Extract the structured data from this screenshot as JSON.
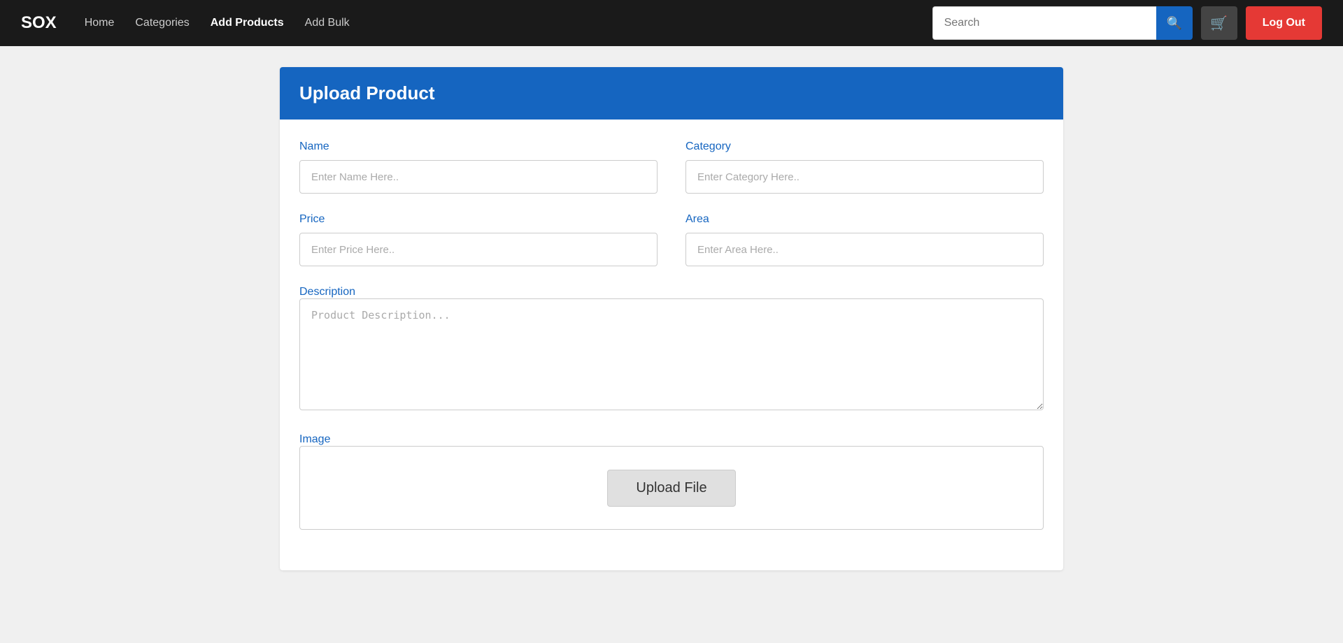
{
  "brand": "SOX",
  "navbar": {
    "links": [
      {
        "label": "Home",
        "active": false
      },
      {
        "label": "Categories",
        "active": false
      },
      {
        "label": "Add Products",
        "active": true
      },
      {
        "label": "Add Bulk",
        "active": false
      }
    ],
    "search_placeholder": "Search",
    "logout_label": "Log Out"
  },
  "form": {
    "title": "Upload Product",
    "name_label": "Name",
    "name_placeholder": "Enter Name Here..",
    "category_label": "Category",
    "category_placeholder": "Enter Category Here..",
    "price_label": "Price",
    "price_placeholder": "Enter Price Here..",
    "area_label": "Area",
    "area_placeholder": "Enter Area Here..",
    "description_label": "Description",
    "description_placeholder": "Product Description...",
    "image_label": "Image",
    "upload_button_label": "Upload File"
  },
  "colors": {
    "navbar_bg": "#1a1a1a",
    "header_bg": "#1565c0",
    "search_btn": "#1565c0",
    "logout_btn": "#e53935"
  }
}
